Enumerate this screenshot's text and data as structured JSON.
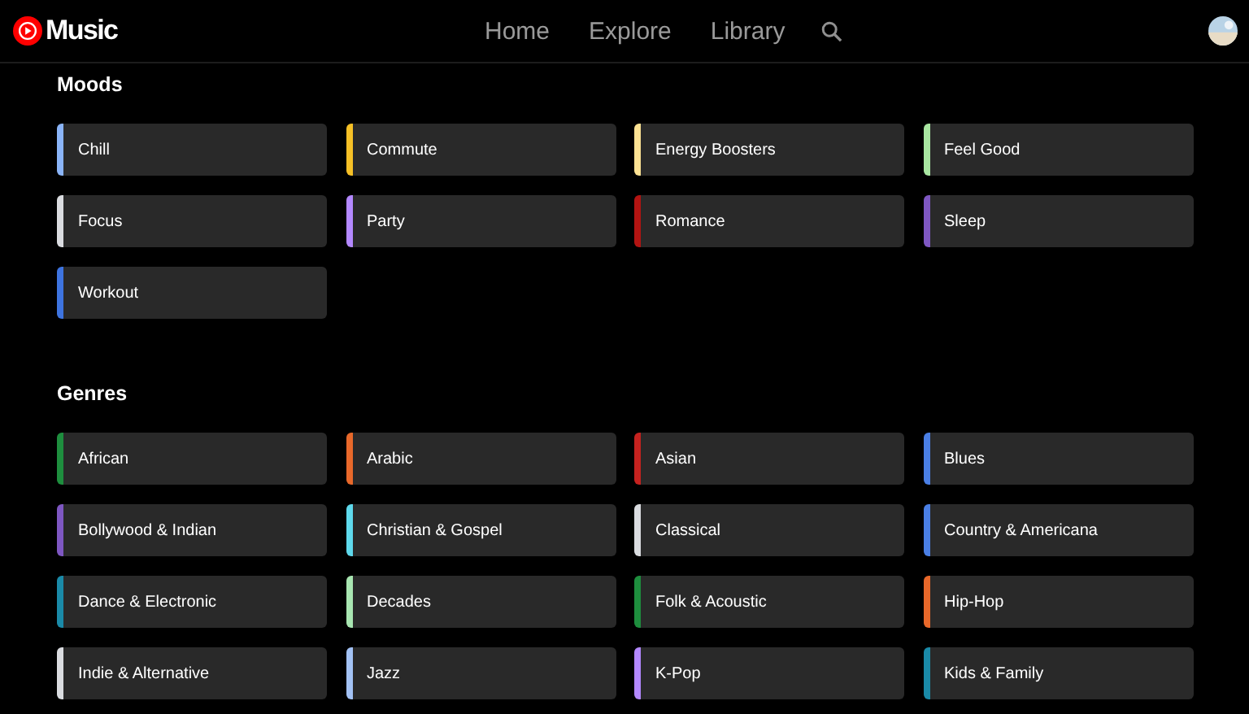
{
  "header": {
    "logo_text": "Music",
    "nav": [
      "Home",
      "Explore",
      "Library"
    ]
  },
  "sections": [
    {
      "title": "Moods",
      "items": [
        {
          "label": "Chill",
          "color": "#8ab4f8"
        },
        {
          "label": "Commute",
          "color": "#f6c026"
        },
        {
          "label": "Energy Boosters",
          "color": "#fde293"
        },
        {
          "label": "Feel Good",
          "color": "#a8e6a1"
        },
        {
          "label": "Focus",
          "color": "#dadce0"
        },
        {
          "label": "Party",
          "color": "#b388ff"
        },
        {
          "label": "Romance",
          "color": "#b31412"
        },
        {
          "label": "Sleep",
          "color": "#7e57c2"
        },
        {
          "label": "Workout",
          "color": "#3e74e0"
        }
      ]
    },
    {
      "title": "Genres",
      "items": [
        {
          "label": "African",
          "color": "#1e8e3e"
        },
        {
          "label": "Arabic",
          "color": "#e8682a"
        },
        {
          "label": "Asian",
          "color": "#c5221f"
        },
        {
          "label": "Blues",
          "color": "#4a7fe5"
        },
        {
          "label": "Bollywood & Indian",
          "color": "#7e57c2"
        },
        {
          "label": "Christian & Gospel",
          "color": "#5ed9ec"
        },
        {
          "label": "Classical",
          "color": "#dadce0"
        },
        {
          "label": "Country & Americana",
          "color": "#4a7fe5"
        },
        {
          "label": "Dance & Electronic",
          "color": "#1a8aa8"
        },
        {
          "label": "Decades",
          "color": "#a8e6b1"
        },
        {
          "label": "Folk & Acoustic",
          "color": "#1e8e3e"
        },
        {
          "label": "Hip-Hop",
          "color": "#e8682a"
        },
        {
          "label": "Indie & Alternative",
          "color": "#dadce0"
        },
        {
          "label": "Jazz",
          "color": "#a3c2f5"
        },
        {
          "label": "K-Pop",
          "color": "#b388ff"
        },
        {
          "label": "Kids & Family",
          "color": "#1a8aa8"
        }
      ]
    }
  ]
}
